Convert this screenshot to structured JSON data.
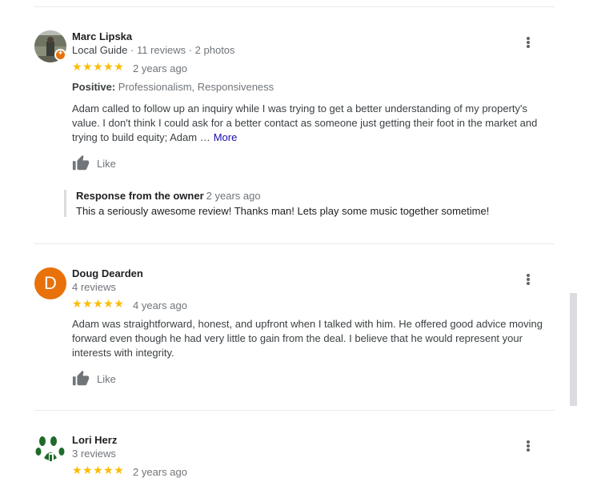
{
  "reviews": [
    {
      "name": "Marc Lipska",
      "guide": "Local Guide",
      "stats": " · 11 reviews · 2 photos",
      "stars": "★★★★★",
      "time": "2 years ago",
      "positive_label": "Positive:",
      "positive_value": " Professionalism, Responsiveness",
      "text": "Adam called to follow up an inquiry while I was trying to get a better understanding of my property's value. I don't think I could ask for a better contact as someone just getting their foot in the market and trying to build equity; Adam …",
      "more": "More",
      "like": "Like",
      "response_title": "Response from the owner",
      "response_time": "2 years ago",
      "response_text": "This a seriously awesome review! Thanks man! Lets play some music together sometime!"
    },
    {
      "name": "Doug Dearden",
      "initial": "D",
      "stats": "4 reviews",
      "stars": "★★★★★",
      "time": "4 years ago",
      "text": "Adam was straightforward, honest, and upfront when I talked with him.  He offered good advice moving forward even though he had very little to gain from the deal.  I believe that he would represent your interests with integrity.",
      "like": "Like"
    },
    {
      "name": "Lori Herz",
      "stats": "3 reviews",
      "stars": "★★★★★",
      "time": "2 years ago"
    }
  ],
  "colors": {
    "star": "#fbbc04",
    "avatar_d": "#e8710a",
    "link": "#1a0dab"
  },
  "icons": [
    "thumbs-up-icon",
    "more-vert-icon",
    "local-guide-badge-icon"
  ]
}
